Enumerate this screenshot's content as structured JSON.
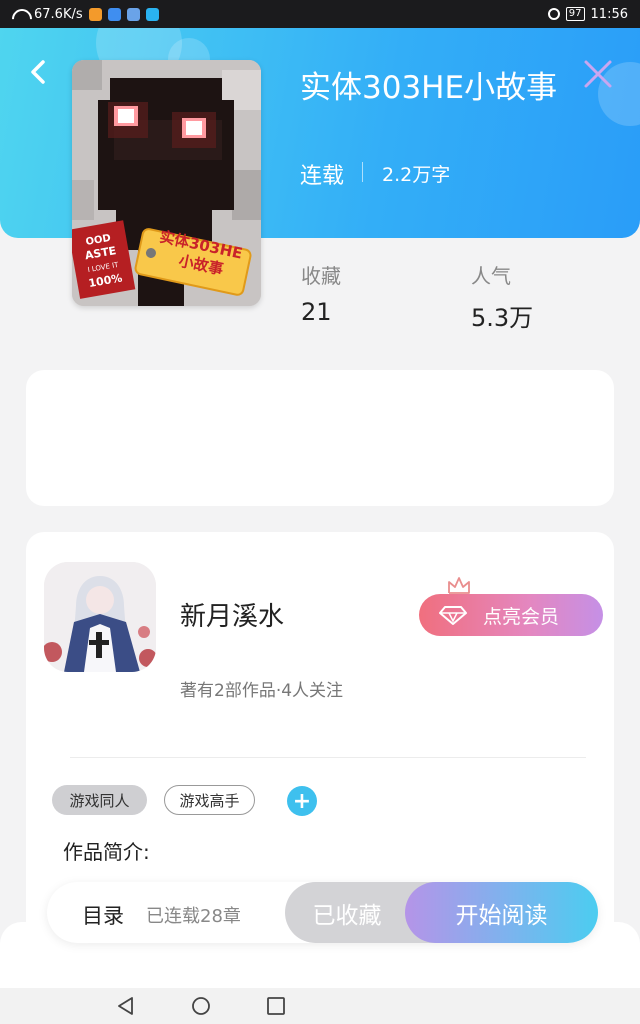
{
  "status_bar": {
    "network_speed": "67.6K/s",
    "battery": "97",
    "time": "11:56"
  },
  "book": {
    "title": "实体303HE小故事",
    "status": "连载",
    "word_count": "2.2万字",
    "cover_text": "实体303HE 小故事",
    "cover_badge": "OOD ASTE I LOVE IT 100%"
  },
  "stats": {
    "favorites_label": "收藏",
    "favorites_value": "21",
    "popularity_label": "人气",
    "popularity_value": "5.3万"
  },
  "author": {
    "name": "新月溪水",
    "meta": "著有2部作品·4人关注",
    "vip_button": "点亮会员"
  },
  "tags": [
    "游戏同人",
    "游戏高手"
  ],
  "intro_label": "作品简介:",
  "actions": {
    "toc_label": "目录",
    "toc_count": "已连载28章",
    "collected_button": "已收藏",
    "read_button": "开始阅读"
  },
  "colors": {
    "header_start": "#4fd5ef",
    "header_end": "#2a9df8",
    "add_tag": "#3ec0ee"
  },
  "icons": [
    "wifi-icon",
    "back-icon",
    "close-icon",
    "diamond-icon",
    "crown-icon",
    "add-icon",
    "nav-back-icon",
    "nav-home-icon",
    "nav-recent-icon"
  ]
}
